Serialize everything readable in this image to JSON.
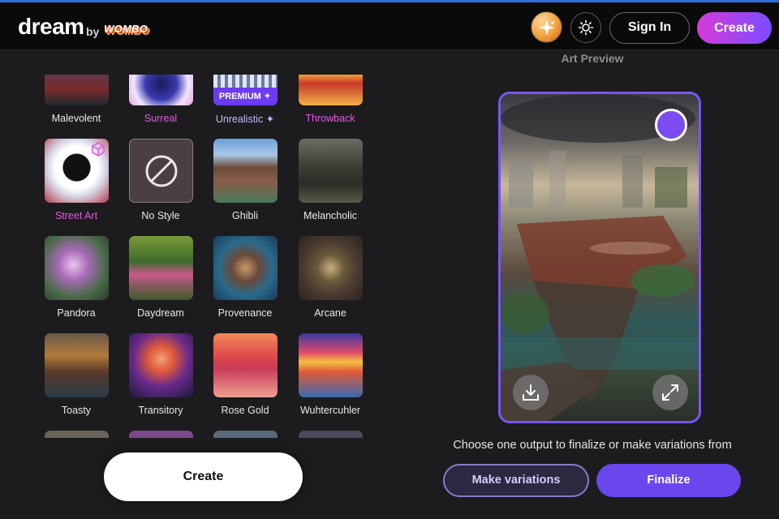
{
  "header": {
    "logo": "dream",
    "by": "by",
    "brand": "WOMBO",
    "sign_in": "Sign In",
    "create": "Create"
  },
  "styles": {
    "items": [
      {
        "label": "Malevolent",
        "tone": "default"
      },
      {
        "label": "Surreal",
        "tone": "pink"
      },
      {
        "label": "Unrealistic ✦",
        "tone": "purple",
        "badge": "PREMIUM ✦"
      },
      {
        "label": "Throwback",
        "tone": "pink"
      },
      {
        "label": "Street Art",
        "tone": "pink"
      },
      {
        "label": "No Style",
        "tone": "default"
      },
      {
        "label": "Ghibli",
        "tone": "default"
      },
      {
        "label": "Melancholic",
        "tone": "default"
      },
      {
        "label": "Pandora",
        "tone": "default"
      },
      {
        "label": "Daydream",
        "tone": "default"
      },
      {
        "label": "Provenance",
        "tone": "default"
      },
      {
        "label": "Arcane",
        "tone": "default"
      },
      {
        "label": "Toasty",
        "tone": "default"
      },
      {
        "label": "Transitory",
        "tone": "default"
      },
      {
        "label": "Rose Gold",
        "tone": "default"
      },
      {
        "label": "Wuhtercuhler",
        "tone": "default"
      }
    ]
  },
  "main": {
    "create_button": "Create"
  },
  "preview": {
    "title": "Art Preview",
    "hint": "Choose one output to finalize or make variations from",
    "make_variations": "Make variations",
    "finalize": "Finalize"
  },
  "colors": {
    "accent_purple": "#6a46ee",
    "pink": "#e35ae0",
    "topbar_stripe": "#2f6fd8"
  }
}
